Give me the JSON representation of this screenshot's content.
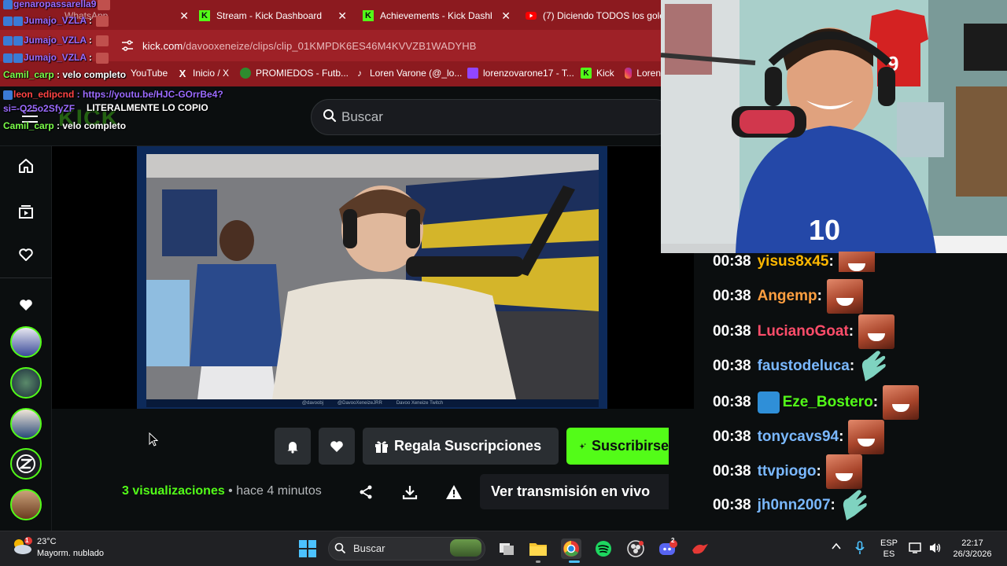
{
  "browser": {
    "tabs": [
      {
        "title": "WhatsApp",
        "favicon": "whatsapp-icon",
        "color": "#25d366"
      },
      {
        "title": "Stream - Kick Dashboard",
        "favicon": "kick-icon",
        "color": "#53fc18"
      },
      {
        "title": "Achievements - Kick Dashbo",
        "favicon": "kick-icon",
        "color": "#53fc18"
      },
      {
        "title": "(7) Diciendo TODOS los gole",
        "favicon": "youtube-icon",
        "color": "#ff0000"
      }
    ],
    "url_domain": "kick.com",
    "url_path": "/davooxeneize/clips/clip_01KMPDK6ES46M4KVVZB1WADYHB",
    "bookmarks": [
      {
        "label": "YouTube",
        "icon": "youtube-icon"
      },
      {
        "label": "Inicio / X",
        "icon": "x-icon"
      },
      {
        "label": "PROMIEDOS - Futb...",
        "icon": "promiedos-icon"
      },
      {
        "label": "Loren Varone (@_lo...",
        "icon": "tiktok-icon"
      },
      {
        "label": "lorenzovarone17 - T...",
        "icon": "twitch-icon"
      },
      {
        "label": "Kick",
        "icon": "kick-icon"
      },
      {
        "label": "Loren",
        "icon": "instagram-icon"
      }
    ]
  },
  "overlay_chat": [
    {
      "user": "genaropassarella9",
      "text": "",
      "color": "purple"
    },
    {
      "user": "Jumajo_VZLA",
      "text": "",
      "color": "purple"
    },
    {
      "user": "Jumajo_VZLA",
      "text": "",
      "color": "purple"
    },
    {
      "user": "Jumajo_VZLA",
      "text": "",
      "color": "purple"
    },
    {
      "user": "Camil_carp",
      "text": "velo completo",
      "color": "green"
    },
    {
      "user": "leon_edipcnd",
      "text": "https://youtu.be/HJC-GOrrBe4?si=-Q25o2SfyZF",
      "color": "red"
    },
    {
      "user": "",
      "text": "LITERALMENTE LO COPIO",
      "color": "purple"
    },
    {
      "user": "Camil_carp",
      "text": "velo completo",
      "color": "green"
    }
  ],
  "kick": {
    "search_placeholder": "Buscar",
    "actions": {
      "gift_label": "Regala Suscripciones",
      "subscribe_label": "Suscribirse"
    },
    "views_count": "3 visualizaciones",
    "views_sep": " • ",
    "time_ago": "hace 4 minutos",
    "watch_live_label": "Ver transmisión en vivo",
    "video_caption": [
      "@davoobj",
      "@DavooXeneizeJRR",
      "Davoo Xeneize Twitch"
    ],
    "accent": "#53fc18"
  },
  "right_chat": [
    {
      "time": "00:38",
      "user": "yisus8x45",
      "color": "#ffb800",
      "emote": "laugh"
    },
    {
      "time": "00:38",
      "user": "Angemp",
      "color": "#ff9f40",
      "emote": "laugh"
    },
    {
      "time": "00:38",
      "user": "LucianoGoat",
      "color": "#ff4d6a",
      "emote": "laugh"
    },
    {
      "time": "00:38",
      "user": "faustodeluca",
      "color": "#7ab8ff",
      "emote": "clap"
    },
    {
      "time": "00:38",
      "user": "Eze_Bostero",
      "color": "#53fc18",
      "emote": "laugh",
      "badge": "hammer"
    },
    {
      "time": "00:38",
      "user": "tonycavs94",
      "color": "#7ab8ff",
      "emote": "laugh"
    },
    {
      "time": "00:38",
      "user": "ttvpiogo",
      "color": "#7ab8ff",
      "emote": "laugh"
    },
    {
      "time": "00:38",
      "user": "jh0nn2007",
      "color": "#7ab8ff",
      "emote": "clap"
    }
  ],
  "taskbar": {
    "temperature": "23°C",
    "weather": "Mayorm. nublado",
    "weather_badge": "1",
    "search_placeholder": "Buscar",
    "discord_badge": "2",
    "language_top": "ESP",
    "language_bottom": "ES",
    "time": "22:17",
    "date": "26/3/2026"
  }
}
